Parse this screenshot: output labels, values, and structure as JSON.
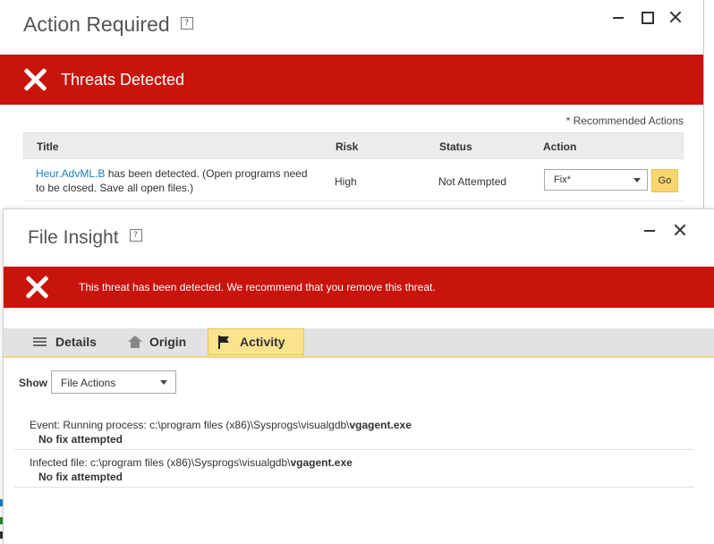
{
  "back_window": {
    "title": "Action Required",
    "help": "?",
    "banner_text": "Threats Detected",
    "recommended_note": "* Recommended Actions",
    "table": {
      "headers": {
        "title": "Title",
        "risk": "Risk",
        "status": "Status",
        "action": "Action"
      },
      "rows": [
        {
          "threat_name": "Heur.AdvML.B",
          "description": " has been detected. (Open programs need to be closed. Save all open files.)",
          "risk": "High",
          "status": "Not Attempted",
          "action_selected": "Fix*",
          "go_label": "Go"
        }
      ]
    }
  },
  "front_window": {
    "title": "File Insight",
    "help": "?",
    "banner_text": "This threat has been detected. We recommend that you remove this threat.",
    "tabs": {
      "details": "Details",
      "origin": "Origin",
      "activity": "Activity"
    },
    "show_label": "Show",
    "show_selected": "File Actions",
    "events": [
      {
        "prefix": "Event: Running process: c:\\program files (x86)\\Sysprogs\\visualgdb\\",
        "file": "vgagent.exe",
        "result": "No fix attempted"
      },
      {
        "prefix": "Infected file: c:\\program files (x86)\\Sysprogs\\visualgdb\\",
        "file": "vgagent.exe",
        "result": "No fix attempted"
      }
    ]
  },
  "colors": {
    "alert_red": "#c8140c",
    "link_blue": "#1a7fc1",
    "active_tab": "#fbe38e",
    "go_button": "#f9d56e"
  }
}
